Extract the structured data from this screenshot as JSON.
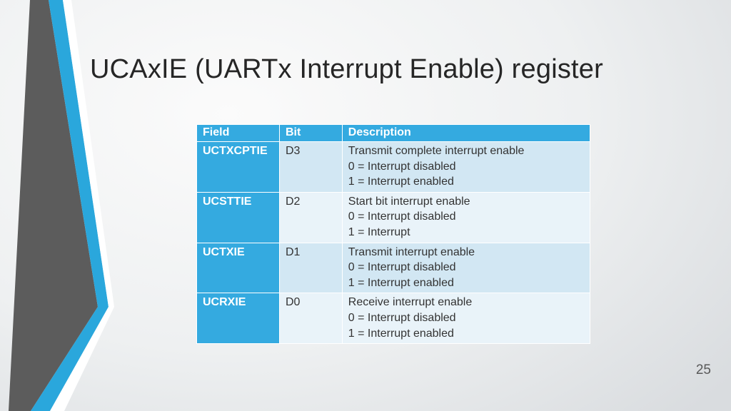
{
  "title": "UCAxIE (UARTx Interrupt Enable) register",
  "page_number": "25",
  "table": {
    "headers": {
      "field": "Field",
      "bit": "Bit",
      "desc": "Description"
    },
    "rows": [
      {
        "field": "UCTXCPTIE",
        "bit": "D3",
        "desc": [
          "Transmit complete interrupt enable",
          "0 = Interrupt disabled",
          "1 = Interrupt enabled"
        ]
      },
      {
        "field": "UCSTTIE",
        "bit": "D2",
        "desc": [
          "Start bit interrupt enable",
          "0 = Interrupt disabled",
          "1 = Interrupt"
        ]
      },
      {
        "field": "UCTXIE",
        "bit": "D1",
        "desc": [
          "Transmit interrupt enable",
          "0 = Interrupt disabled",
          "1 = Interrupt enabled"
        ]
      },
      {
        "field": "UCRXIE",
        "bit": "D0",
        "desc": [
          "Receive interrupt enable",
          "0 = Interrupt disabled",
          "1 = Interrupt enabled"
        ]
      }
    ]
  }
}
